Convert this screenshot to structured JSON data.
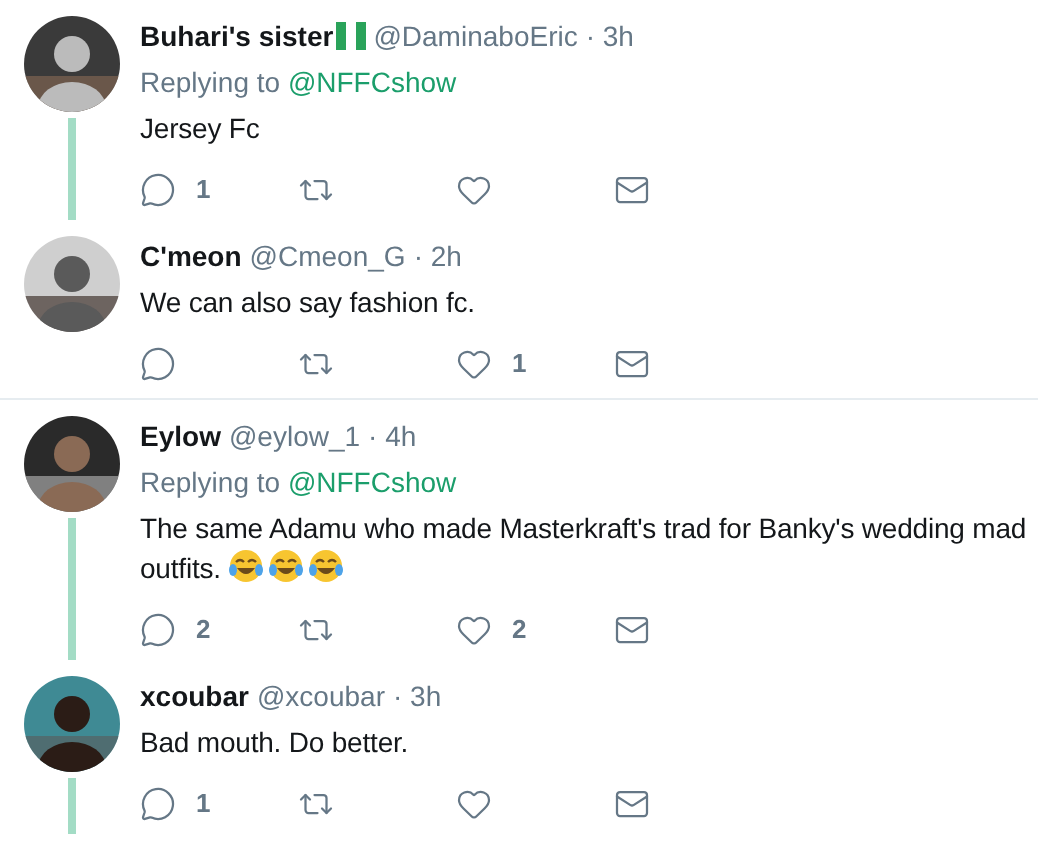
{
  "conversations": [
    {
      "tweets": [
        {
          "name": "Buhari's sister",
          "flag": true,
          "handle": "@DaminaboEric",
          "time": "· 3h",
          "replying_label": "Replying to",
          "replying_to": "@NFFCshow",
          "text_lines": [
            "Jersey Fc"
          ],
          "replies": "1",
          "thread_line": true
        },
        {
          "name": "C'meon",
          "flag": false,
          "handle": "@Cmeon_G",
          "time": "· 2h",
          "text_lines": [
            "We can also say fashion fc."
          ],
          "likes": "1",
          "thread_line": false
        }
      ]
    },
    {
      "tweets": [
        {
          "name": "Eylow",
          "flag": false,
          "handle": "@eylow_1",
          "time": "· 4h",
          "replying_label": "Replying to",
          "replying_to": "@NFFCshow",
          "text_lines": [
            "The same Adamu who made Masterkraft's trad for Banky's wedding mad",
            "outfits."
          ],
          "emojis": [
            {
              "kind": "tears-of-joy"
            },
            {
              "kind": "tears-of-joy"
            },
            {
              "kind": "tears-of-joy"
            }
          ],
          "replies": "2",
          "likes": "2",
          "thread_line": true
        },
        {
          "name": "xcoubar",
          "flag": false,
          "handle": "@xcoubar",
          "time": "· 3h",
          "text_lines": [
            "Bad mouth. Do better."
          ],
          "replies": "1",
          "thread_line": true
        }
      ]
    }
  ]
}
